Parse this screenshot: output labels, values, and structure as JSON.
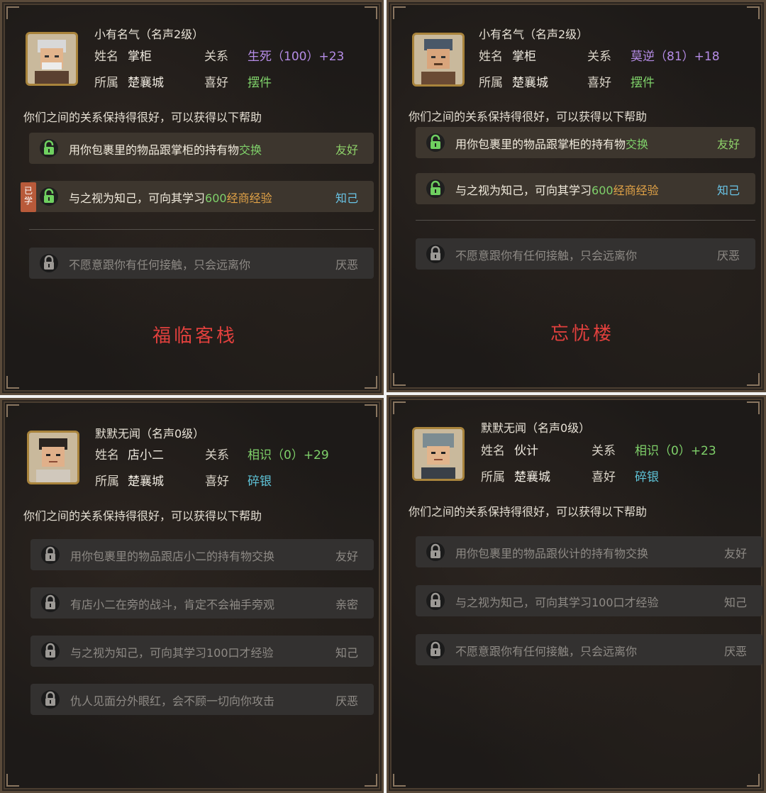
{
  "colors": {
    "panel_bg": "#1d1a18",
    "row_bg": "#36312b",
    "relation_purple": "#b58ce6",
    "relation_green": "#7fd16a",
    "hobby_green": "#7fd16a",
    "hobby_teal": "#5fc4d8",
    "tag_green": "#8fd36a",
    "tag_teal": "#69c4e6",
    "place_red": "#e0403d",
    "learned_badge": "#b85a3a"
  },
  "labels": {
    "name": "姓名",
    "relation": "关系",
    "affiliation": "所属",
    "hobby": "喜好"
  },
  "panels": [
    {
      "reputation": "小有名气（名声2级）",
      "name": "掌柜",
      "relation": "生死（100）+23",
      "affiliation": "楚襄城",
      "hobby": "摆件",
      "help_intro": "你们之间的关系保持得很好，可以获得以下帮助",
      "benefits": [
        {
          "text_pre": "用你包裹里的物品跟掌柜的持有物",
          "text_hl": "交换",
          "text_hl2": "",
          "tag": "友好",
          "state": "active",
          "learned": ""
        },
        {
          "text_pre": "与之视为知己，可向其学习",
          "text_hl": "600",
          "text_hl2": "经商经验",
          "tag": "知己",
          "state": "active",
          "learned": "已学"
        },
        {
          "text_pre": "不愿意跟你有任何接触，只会远离你",
          "text_hl": "",
          "text_hl2": "",
          "tag": "厌恶",
          "state": "dim",
          "learned": ""
        }
      ],
      "place": "福临客栈",
      "avatar_icon": "old-man-portrait-icon"
    },
    {
      "reputation": "小有名气（名声2级）",
      "name": "掌柜",
      "relation": "莫逆（81）+18",
      "affiliation": "楚襄城",
      "hobby": "摆件",
      "help_intro": "你们之间的关系保持得很好，可以获得以下帮助",
      "benefits": [
        {
          "text_pre": "用你包裹里的物品跟掌柜的持有物",
          "text_hl": "交换",
          "text_hl2": "",
          "tag": "友好",
          "state": "active",
          "learned": ""
        },
        {
          "text_pre": "与之视为知己，可向其学习",
          "text_hl": "600",
          "text_hl2": "经商经验",
          "tag": "知己",
          "state": "active",
          "learned": ""
        },
        {
          "text_pre": "不愿意跟你有任何接触，只会远离你",
          "text_hl": "",
          "text_hl2": "",
          "tag": "厌恶",
          "state": "dim",
          "learned": ""
        }
      ],
      "place": "忘忧楼",
      "avatar_icon": "hat-man-portrait-icon"
    },
    {
      "reputation": "默默无闻（名声0级）",
      "name": "店小二",
      "relation": "相识（0）+29",
      "affiliation": "楚襄城",
      "hobby": "碎银",
      "help_intro": "你们之间的关系保持得很好，可以获得以下帮助",
      "benefits": [
        {
          "text_pre": "用你包裹里的物品跟店小二的持有物交换",
          "text_hl": "",
          "text_hl2": "",
          "tag": "友好",
          "state": "dim",
          "learned": ""
        },
        {
          "text_pre": "有店小二在旁的战斗，肯定不会袖手旁观",
          "text_hl": "",
          "text_hl2": "",
          "tag": "亲密",
          "state": "dim",
          "learned": ""
        },
        {
          "text_pre": "与之视为知己，可向其学习100口才经验",
          "text_hl": "",
          "text_hl2": "",
          "tag": "知己",
          "state": "dim",
          "learned": ""
        },
        {
          "text_pre": "仇人见面分外眼红，会不顾一切向你攻击",
          "text_hl": "",
          "text_hl2": "",
          "tag": "厌恶",
          "state": "dim",
          "learned": ""
        }
      ],
      "avatar_icon": "young-man-portrait-icon"
    },
    {
      "reputation": "默默无闻（名声0级）",
      "name": "伙计",
      "relation": "相识（0）+23",
      "affiliation": "楚襄城",
      "hobby": "碎银",
      "help_intro": "你们之间的关系保持得很好，可以获得以下帮助",
      "benefits": [
        {
          "text_pre": "用你包裹里的物品跟伙计的持有物交换",
          "text_hl": "",
          "text_hl2": "",
          "tag": "友好",
          "state": "dim",
          "learned": ""
        },
        {
          "text_pre": "与之视为知己，可向其学习100口才经验",
          "text_hl": "",
          "text_hl2": "",
          "tag": "知己",
          "state": "dim",
          "learned": ""
        },
        {
          "text_pre": "不愿意跟你有任何接触，只会远离你",
          "text_hl": "",
          "text_hl2": "",
          "tag": "厌恶",
          "state": "dim",
          "learned": ""
        }
      ],
      "avatar_icon": "cap-boy-portrait-icon"
    }
  ]
}
